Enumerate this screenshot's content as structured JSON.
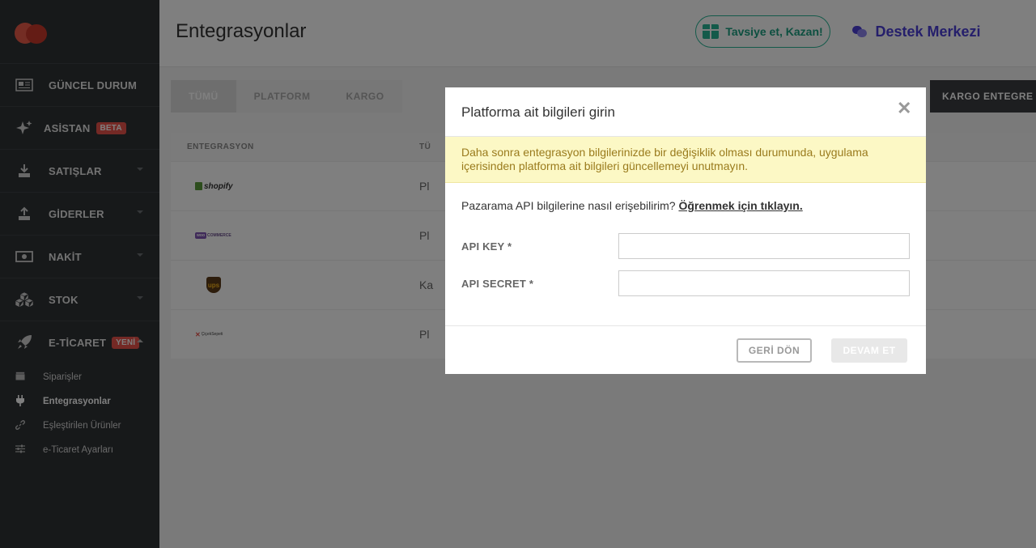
{
  "sidebar": {
    "items": [
      {
        "label": "GÜNCEL DURUM",
        "icon": "newspaper-icon"
      },
      {
        "label": "ASİSTAN",
        "icon": "sparkle-icon",
        "badge": "BETA"
      },
      {
        "label": "SATIŞLAR",
        "icon": "download-icon"
      },
      {
        "label": "GİDERLER",
        "icon": "upload-icon"
      },
      {
        "label": "NAKİT",
        "icon": "money-icon"
      },
      {
        "label": "STOK",
        "icon": "boxes-icon"
      },
      {
        "label": "E-TİCARET",
        "icon": "rocket-icon",
        "badge": "YENİ"
      }
    ],
    "subitems": [
      {
        "label": "Siparişler",
        "icon": "package-icon"
      },
      {
        "label": "Entegrasyonlar",
        "icon": "plug-icon"
      },
      {
        "label": "Eşleştirilen Ürünler",
        "icon": "link-icon"
      },
      {
        "label": "e-Ticaret Ayarları",
        "icon": "sliders-icon"
      }
    ]
  },
  "header": {
    "title": "Entegrasyonlar",
    "referral_label": "Tavsiye et, Kazan!",
    "help_label": "Destek Merkezi"
  },
  "tabs": [
    "TÜMÜ",
    "PLATFORM",
    "KARGO"
  ],
  "cargo_button": "KARGO ENTEGRE E",
  "table": {
    "headers": [
      "ENTEGRASYON",
      "TÜ"
    ],
    "rows": [
      {
        "logo": "shopify",
        "type": "Pl"
      },
      {
        "logo": "COMMERCE",
        "type": "Pl"
      },
      {
        "logo": "ups",
        "type": "Ka"
      },
      {
        "logo": "ÇiçekSepeti",
        "type": "Pl"
      }
    ]
  },
  "modal": {
    "title": "Platforma ait bilgileri girin",
    "warning": "Daha sonra entegrasyon bilgilerinizde bir değişiklik olması durumunda, uygulama içerisinden platforma ait bilgileri güncellemeyi unutmayın.",
    "info_text": "Pazarama API bilgilerine nasıl erişebilirim?",
    "info_link": "Öğrenmek için tıklayın.",
    "api_key_label": "API KEY *",
    "api_key_value": "",
    "api_secret_label": "API SECRET *",
    "api_secret_value": "",
    "back_button": "GERİ DÖN",
    "next_button": "DEVAM ET"
  },
  "colors": {
    "accent_green": "#29b595",
    "accent_purple": "#4a3fd6",
    "badge_red": "#e8534a",
    "warning_bg": "#fcf8c5"
  }
}
